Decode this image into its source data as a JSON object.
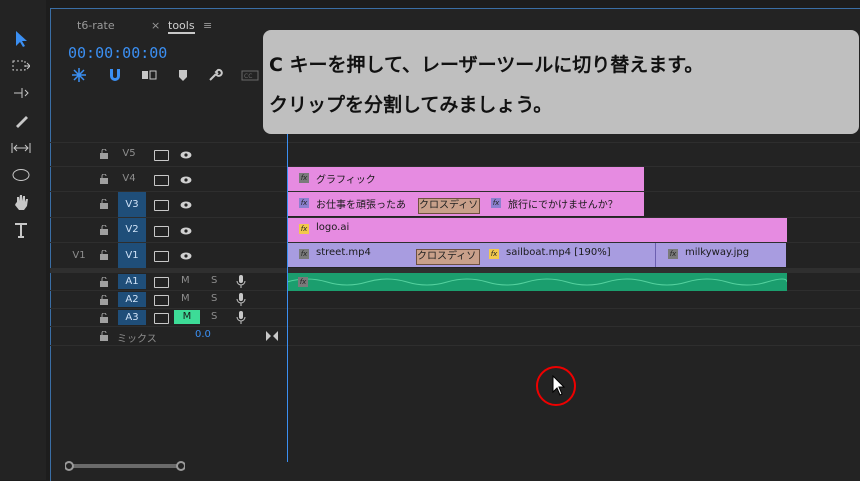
{
  "tabs": [
    {
      "label": "t6-rate"
    },
    {
      "label": "tools",
      "close": "×",
      "menu": "≡"
    }
  ],
  "timecode": "00:00:00:00",
  "tooltip": {
    "line1": "C キーを押して、レーザーツールに切り替えます。",
    "line2": "クリップを分割してみましょう。"
  },
  "tracks": {
    "video": [
      {
        "id": "V5",
        "label": "V5",
        "highlight": false,
        "src": ""
      },
      {
        "id": "V4",
        "label": "V4",
        "highlight": false,
        "src": ""
      },
      {
        "id": "V3",
        "label": "V3",
        "highlight": true,
        "src": ""
      },
      {
        "id": "V2",
        "label": "V2",
        "highlight": true,
        "src": ""
      },
      {
        "id": "V1",
        "label": "V1",
        "highlight": true,
        "src": "V1"
      }
    ],
    "audio": [
      {
        "id": "A1",
        "label": "A1",
        "m": "M",
        "s": "S"
      },
      {
        "id": "A2",
        "label": "A2",
        "m": "M",
        "s": "S"
      },
      {
        "id": "A3",
        "label": "A3",
        "m": "M",
        "s": "S"
      }
    ],
    "mix": {
      "label": "ミックス",
      "value": "0.0"
    }
  },
  "clips": {
    "v4_graphic": "グラフィック",
    "v3_a": "お仕事を頑張ったあ",
    "v3_trans": "クロスディソ",
    "v3_b": "旅行にでかけませんか？",
    "v2_logo": "logo.ai",
    "v1_street": "street.mp4",
    "v1_trans": "クロスディソ",
    "v1_sailboat": "sailboat.mp4 [190%]",
    "v1_milky": "milkyway.jpg",
    "fx": "fx"
  },
  "colors": {
    "accent": "#3b8ff2",
    "clip_pink": "#e68be1",
    "clip_purple": "#a89ce0",
    "audio": "#1b9e6e",
    "tooltip_bg": "#bfbfbf",
    "cursor_ring": "#ee0000"
  }
}
